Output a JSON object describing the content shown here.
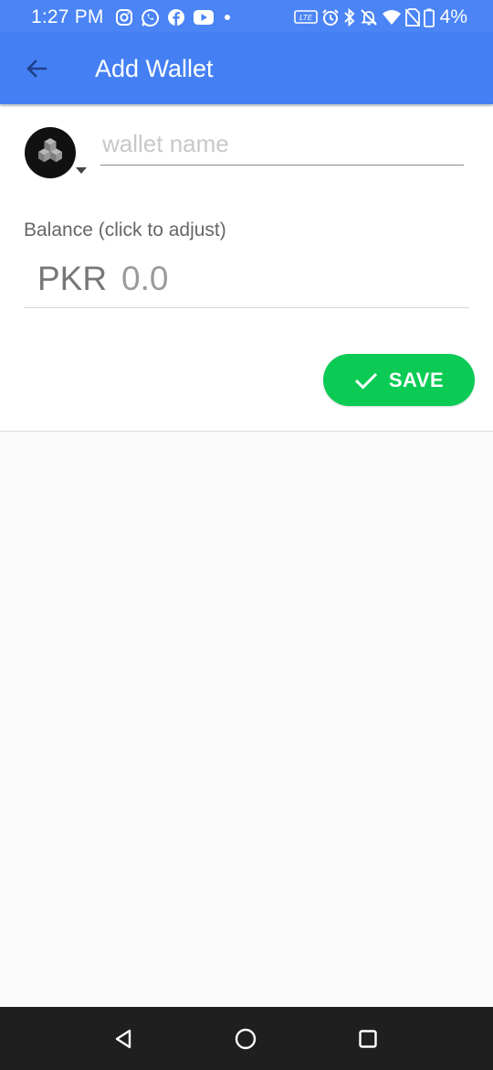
{
  "status_bar": {
    "time": "1:27 PM",
    "battery": "4%",
    "app_icons": [
      "instagram-icon",
      "whatsapp-icon",
      "facebook-icon",
      "youtube-icon",
      "dot-icon"
    ],
    "system_icons": [
      "volte-icon",
      "alarm-icon",
      "bluetooth-icon",
      "mute-icon",
      "wifi-icon",
      "no-sim-icon",
      "battery-icon"
    ]
  },
  "app_bar": {
    "title": "Add Wallet",
    "color": "#4480f4"
  },
  "form": {
    "wallet_name": {
      "value": "",
      "placeholder": "wallet name"
    },
    "balance": {
      "label": "Balance (click to adjust)",
      "currency": "PKR",
      "amount": "0.0"
    },
    "save": {
      "label": "SAVE",
      "color": "#0ccb55"
    }
  },
  "nav_bar": {
    "buttons": [
      "back-icon",
      "home-icon",
      "recents-icon"
    ]
  }
}
